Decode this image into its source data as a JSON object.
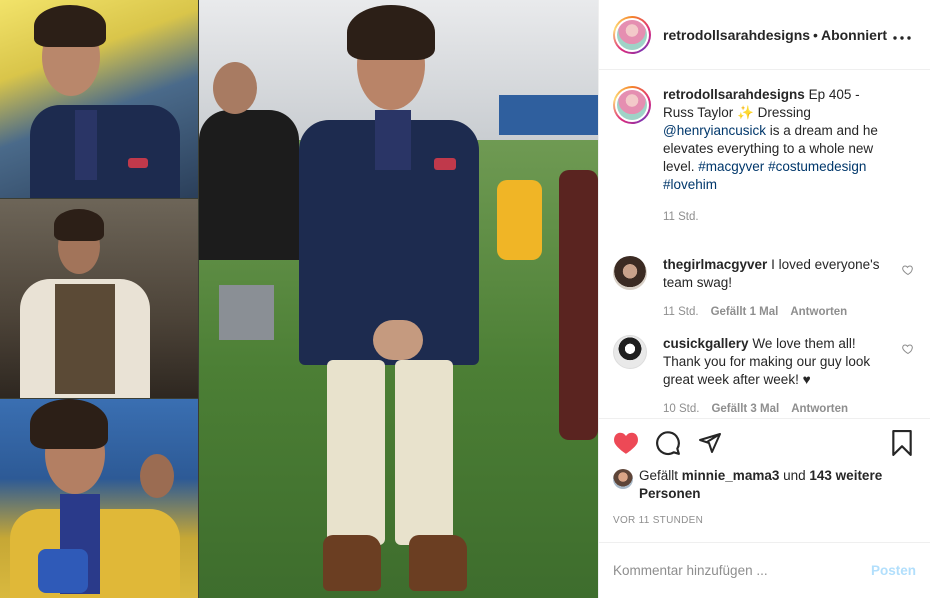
{
  "header": {
    "username": "retrodollsarahdesigns",
    "separator": "•",
    "follow_label": "Abonniert",
    "more_icon": "more-horizontal-icon"
  },
  "caption": {
    "username": "retrodollsarahdesigns",
    "text_before": "Ep 405 - Russ Taylor",
    "emoji": "✨",
    "text_after": "Dressing",
    "mention": "@henryiancusick",
    "text_tail": "is a dream and he elevates everything to a whole new level.",
    "hashtags": [
      "#macgyver",
      "#costumedesign",
      "#lovehim"
    ],
    "time": "11 Std."
  },
  "comments": [
    {
      "username": "thegirlmacgyver",
      "text": "I loved everyone's team swag!",
      "time": "11 Std.",
      "likes": "Gefällt 1 Mal",
      "reply": "Antworten"
    },
    {
      "username": "cusickgallery",
      "text": "We love them all! Thank you for making our guy look great week after week! ♥",
      "time": "10 Std.",
      "likes": "Gefällt 3 Mal",
      "reply": "Antworten"
    }
  ],
  "likes": {
    "prefix": "Gefällt",
    "user": "minnie_mama3",
    "middle": "und",
    "others": "143 weitere Personen"
  },
  "timestamp": "VOR 11 STUNDEN",
  "comment_box": {
    "placeholder": "Kommentar hinzufügen ...",
    "post_label": "Posten"
  },
  "colors": {
    "like_red": "#ed4956",
    "link_blue": "#00376b",
    "post_disabled": "#b2dffc"
  }
}
